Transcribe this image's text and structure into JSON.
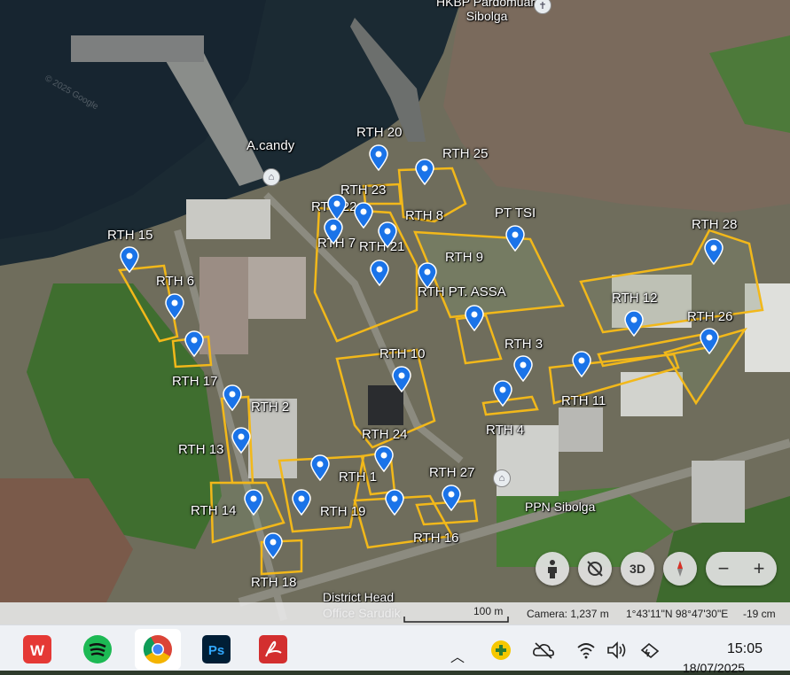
{
  "map": {
    "place_labels": [
      {
        "id": "church",
        "text": "HKBP Pardomuan\nSibolga"
      },
      {
        "id": "a-candy",
        "text": "A.candy"
      },
      {
        "id": "ppn-sibolga",
        "text": "PPN Sibolga"
      },
      {
        "id": "district-head",
        "text": "District Head\nOffice Sarudik"
      }
    ],
    "polygon_labels": [
      "RTH 20",
      "RTH 25",
      "RTH 23",
      "RTH 22",
      "RTH 8",
      "PT TSI",
      "RTH 28",
      "RTH 15",
      "RTH 7",
      "RTH 21",
      "RTH 9",
      "RTH 6",
      "RTH PT. ASSA",
      "RTH 12",
      "RTH 26",
      "RTH 3",
      "RTH 10",
      "RTH 17",
      "RTH 11",
      "RTH 2",
      "RTH 24",
      "RTH 4",
      "RTH 13",
      "RTH 1",
      "RTH 27",
      "RTH 14",
      "RTH 19",
      "RTH 16",
      "RTH 18"
    ],
    "watermark": "© 2025 Google",
    "polygon_color": "#f2b81a",
    "pin_color": "#1a73e8"
  },
  "controls": {
    "button_3d": "3D",
    "zoom_out": "−",
    "zoom_in": "+"
  },
  "statusbar": {
    "scale": "100 m",
    "camera": "Camera: 1,237 m",
    "coords": "1°43'11\"N 98°47'30\"E",
    "elevation": "-19 cm"
  },
  "taskbar": {
    "time": "15:05",
    "date": "18/07/2025",
    "apps": [
      "wps-office",
      "spotify",
      "google-chrome",
      "photoshop",
      "acrobat-reader"
    ]
  }
}
